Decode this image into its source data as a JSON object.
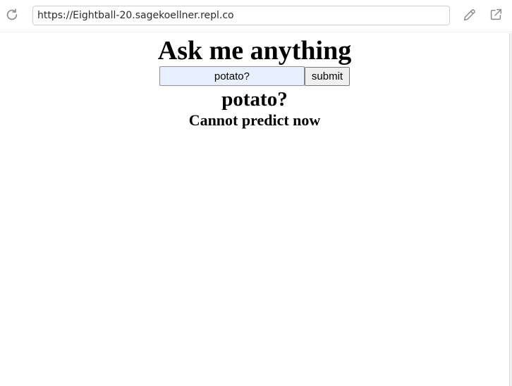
{
  "browser": {
    "url": "https://Eightball-20.sagekoellner.repl.co",
    "icons": {
      "reload": "reload-icon",
      "edit": "pencil-icon",
      "open_external": "external-link-icon"
    },
    "colors": {
      "icon": "#8a8a8a",
      "border": "#cfcfcf"
    }
  },
  "page": {
    "heading": "Ask me anything",
    "form": {
      "question_value": "potato?",
      "submit_label": "submit"
    },
    "question_echo": "potato?",
    "answer": "Cannot predict now",
    "colors": {
      "input_background": "#e8f0fe",
      "button_background": "#efefef"
    }
  }
}
